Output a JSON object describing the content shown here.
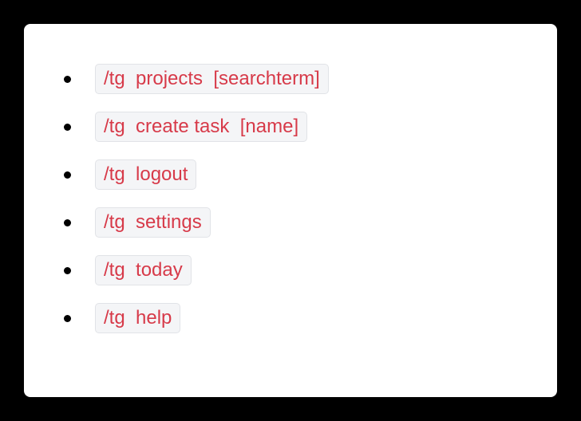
{
  "commands": [
    "/tg  projects  [searchterm]",
    "/tg  create task  [name]",
    "/tg  logout",
    "/tg  settings",
    "/tg  today",
    "/tg  help"
  ]
}
